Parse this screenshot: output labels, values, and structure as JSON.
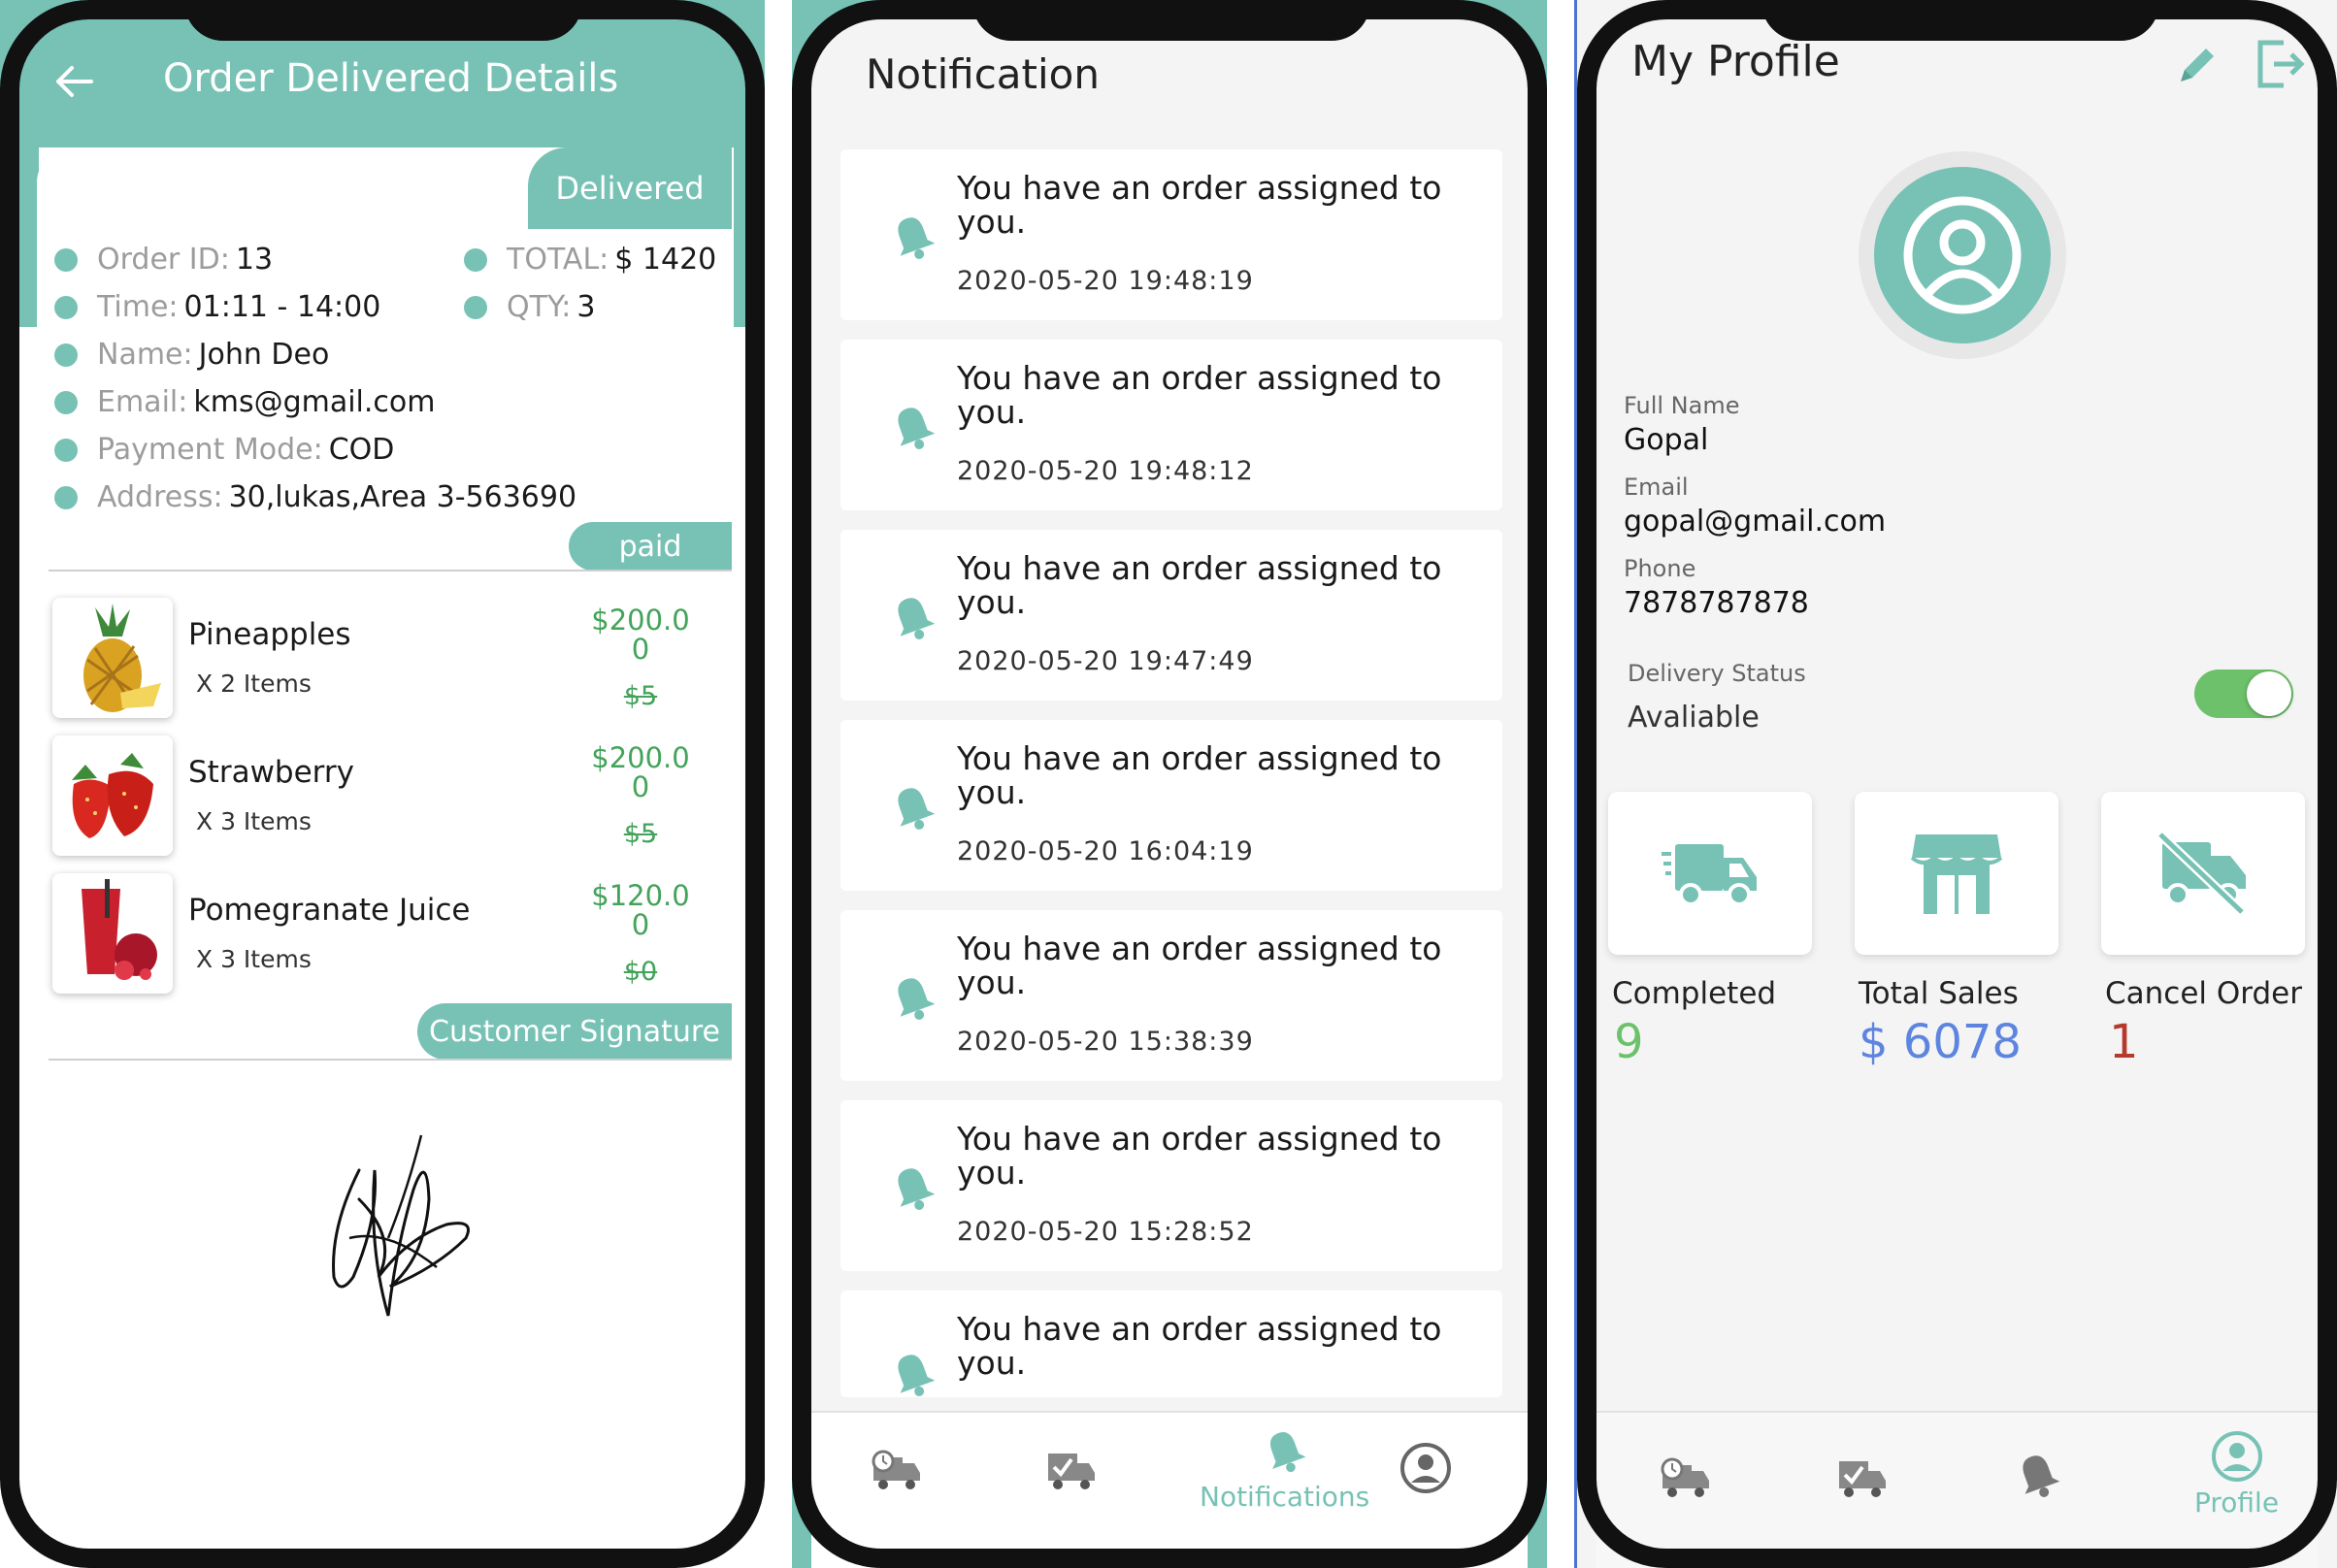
{
  "colors": {
    "accent": "#77c2b5",
    "price": "#43a35a",
    "completed": "#6cc16a",
    "sales": "#5d85e0",
    "cancel": "#b43a2e"
  },
  "order": {
    "title": "Order Delivered Details",
    "status_badge": "Delivered",
    "order_id_label": "Order ID:",
    "order_id": "13",
    "total_label": "TOTAL:",
    "total": "$ 1420",
    "time_label": "Time:",
    "time": "01:11 - 14:00",
    "qty_label": "QTY:",
    "qty": "3",
    "name_label": "Name:",
    "name": "John Deo",
    "email_label": "Email:",
    "email": "kms@gmail.com",
    "payment_label": "Payment Mode:",
    "payment": "COD",
    "address_label": "Address:",
    "address": "30,lukas,Area 3-563690",
    "paid_badge": "paid",
    "items": [
      {
        "name": "Pineapples",
        "qty": "X 2 Items",
        "price_line1": "$200.0",
        "price_line2": "0",
        "unit": "$5"
      },
      {
        "name": "Strawberry",
        "qty": "X 3 Items",
        "price_line1": "$200.0",
        "price_line2": "0",
        "unit": "$5"
      },
      {
        "name": "Pomegranate Juice",
        "qty": "X 3 Items",
        "price_line1": "$120.0",
        "price_line2": "0",
        "unit": "$0"
      }
    ],
    "signature_label": "Customer Signature"
  },
  "notifications": {
    "title": "Notification",
    "items": [
      {
        "message": "You have an order assigned to you.",
        "time": "2020-05-20 19:48:19"
      },
      {
        "message": "You have an order assigned to you.",
        "time": "2020-05-20 19:48:12"
      },
      {
        "message": "You have an order assigned to you.",
        "time": "2020-05-20 19:47:49"
      },
      {
        "message": "You have an order assigned to you.",
        "time": "2020-05-20 16:04:19"
      },
      {
        "message": "You have an order assigned to you.",
        "time": "2020-05-20 15:38:39"
      },
      {
        "message": "You have an order assigned to you.",
        "time": "2020-05-20 15:28:52"
      },
      {
        "message": "You have an order assigned to you.",
        "time": ""
      }
    ],
    "tab_active_label": "Notifications"
  },
  "profile": {
    "title": "My Profile",
    "full_name_label": "Full Name",
    "full_name": "Gopal",
    "email_label": "Email",
    "email": "gopal@gmail.com",
    "phone_label": "Phone",
    "phone": "7878787878",
    "delivery_status_label": "Delivery Status",
    "delivery_status": "Avaliable",
    "stats": [
      {
        "label": "Completed",
        "value": "9",
        "icon": "delivery-truck-icon"
      },
      {
        "label": "Total Sales",
        "value": "$ 6078",
        "icon": "store-icon"
      },
      {
        "label": "Cancel Order",
        "value": "1",
        "icon": "cancelled-truck-icon"
      }
    ],
    "tab_active_label": "Profile"
  }
}
